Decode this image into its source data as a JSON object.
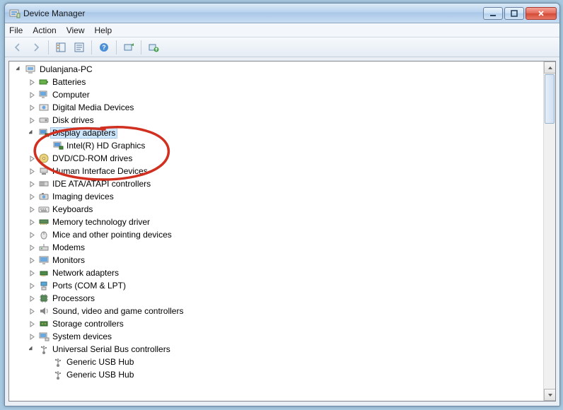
{
  "window": {
    "title": "Device Manager"
  },
  "menu": {
    "file": "File",
    "action": "Action",
    "view": "View",
    "help": "Help"
  },
  "root": {
    "label": "Dulanjana-PC"
  },
  "nodes": {
    "batteries": "Batteries",
    "computer": "Computer",
    "digital_media": "Digital Media Devices",
    "disk_drives": "Disk drives",
    "display_adapters": "Display adapters",
    "intel_hd": "Intel(R) HD Graphics",
    "dvd_cd": "DVD/CD-ROM drives",
    "hid": "Human Interface Devices",
    "ide": "IDE ATA/ATAPI controllers",
    "imaging": "Imaging devices",
    "keyboards": "Keyboards",
    "memtech": "Memory technology driver",
    "mice": "Mice and other pointing devices",
    "modems": "Modems",
    "monitors": "Monitors",
    "network": "Network adapters",
    "ports": "Ports (COM & LPT)",
    "processors": "Processors",
    "sound": "Sound, video and game controllers",
    "storage": "Storage controllers",
    "system": "System devices",
    "usb": "Universal Serial Bus controllers",
    "usb_hub1": "Generic USB Hub",
    "usb_hub2": "Generic USB Hub"
  }
}
